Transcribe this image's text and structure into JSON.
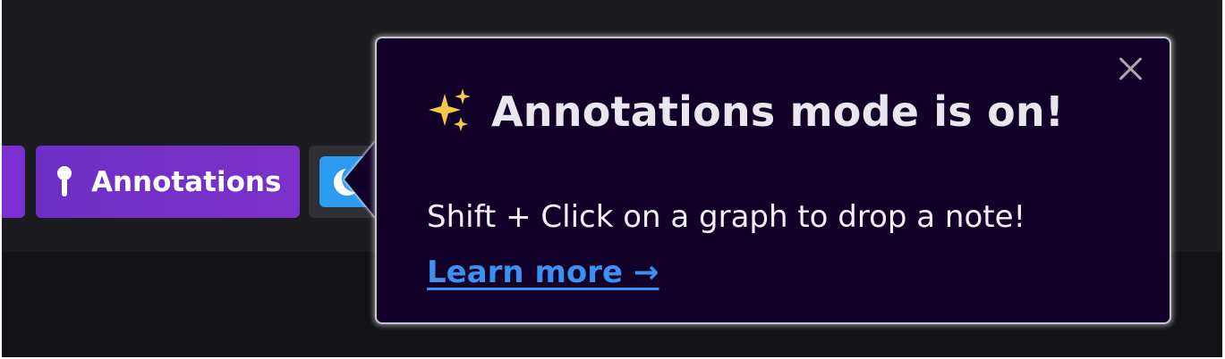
{
  "toolbar": {
    "annotations_button": {
      "label": "Annotations",
      "icon": "pin-icon",
      "color": "#6c2fc6"
    },
    "theme_toggle": {
      "icon": "moon-icon",
      "color": "#2d9cf0"
    }
  },
  "popover": {
    "title_icon": "sparkles-icon",
    "title": "Annotations mode is on!",
    "body": "Shift + Click on a graph to drop a note!",
    "link_label": "Learn more →",
    "close_icon": "close-icon",
    "background": "#110128",
    "link_color": "#3d8ff0"
  }
}
